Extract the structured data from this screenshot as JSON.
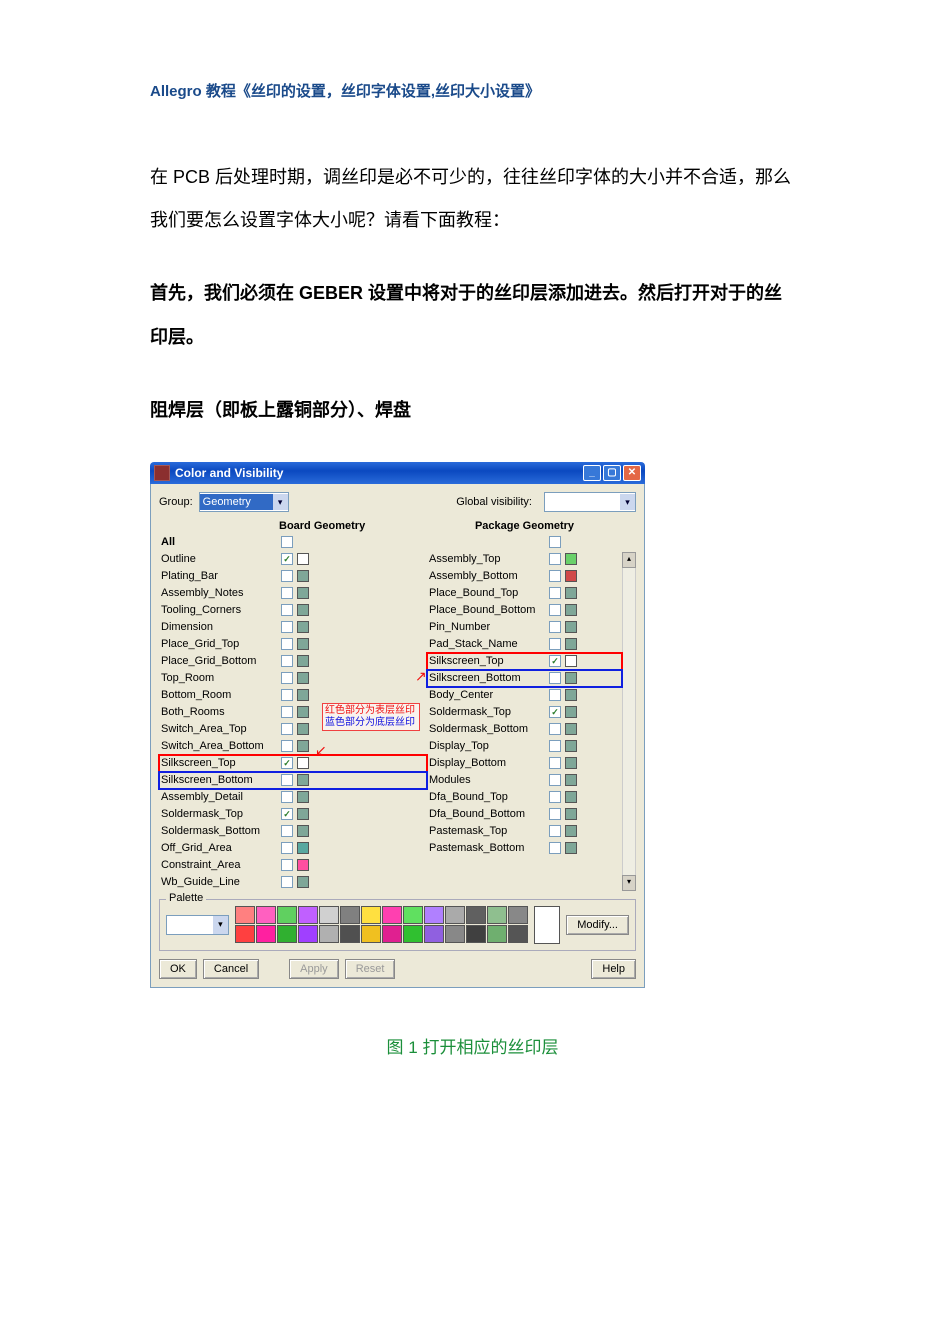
{
  "doc": {
    "title": "Allegro 教程《丝印的设置，丝印字体设置,丝印大小设置》",
    "p1": "在 PCB 后处理时期，调丝印是必不可少的，往往丝印字体的大小并不合适，那么我们要怎么设置字体大小呢？请看下面教程：",
    "p2": "首先，我们必须在 GEBER 设置中将对于的丝印层添加进去。然后打开对于的丝印层。",
    "p3": "阻焊层（即板上露铜部分）、焊盘",
    "caption": "图 1  打开相应的丝印层"
  },
  "dialog": {
    "title": "Color and Visibility",
    "group_label": "Group:",
    "group_value": "Geometry",
    "global_label": "Global visibility:",
    "hdr_left": "Board Geometry",
    "hdr_right": "Package Geometry",
    "all_label": "All",
    "left": [
      {
        "name": "Outline",
        "chk": true,
        "sw": "#ffffff"
      },
      {
        "name": "Plating_Bar",
        "chk": false,
        "sw": "#7fa798"
      },
      {
        "name": "Assembly_Notes",
        "chk": false,
        "sw": "#7fa798"
      },
      {
        "name": "Tooling_Corners",
        "chk": false,
        "sw": "#7fa798"
      },
      {
        "name": "Dimension",
        "chk": false,
        "sw": "#7fa798"
      },
      {
        "name": "Place_Grid_Top",
        "chk": false,
        "sw": "#7fa798"
      },
      {
        "name": "Place_Grid_Bottom",
        "chk": false,
        "sw": "#7fa798"
      },
      {
        "name": "Top_Room",
        "chk": false,
        "sw": "#7fa798"
      },
      {
        "name": "Bottom_Room",
        "chk": false,
        "sw": "#7fa798"
      },
      {
        "name": "Both_Rooms",
        "chk": false,
        "sw": "#7fa798"
      },
      {
        "name": "Switch_Area_Top",
        "chk": false,
        "sw": "#7fa798"
      },
      {
        "name": "Switch_Area_Bottom",
        "chk": false,
        "sw": "#7fa798"
      },
      {
        "name": "Silkscreen_Top",
        "chk": true,
        "sw": "#ffffff",
        "hl": "red"
      },
      {
        "name": "Silkscreen_Bottom",
        "chk": false,
        "sw": "#7fa798",
        "hl": "blue"
      },
      {
        "name": "Assembly_Detail",
        "chk": false,
        "sw": "#7fa798"
      },
      {
        "name": "Soldermask_Top",
        "chk": true,
        "sw": "#7fa798"
      },
      {
        "name": "Soldermask_Bottom",
        "chk": false,
        "sw": "#7fa798"
      },
      {
        "name": "Off_Grid_Area",
        "chk": false,
        "sw": "#58a8a0"
      },
      {
        "name": "Constraint_Area",
        "chk": false,
        "sw": "#ff4fa0"
      },
      {
        "name": "Wb_Guide_Line",
        "chk": false,
        "sw": "#7fa798"
      }
    ],
    "right": [
      {
        "name": "Assembly_Top",
        "chk": false,
        "sw": "#6ad06a"
      },
      {
        "name": "Assembly_Bottom",
        "chk": false,
        "sw": "#d04a4a"
      },
      {
        "name": "Place_Bound_Top",
        "chk": false,
        "sw": "#7fa798"
      },
      {
        "name": "Place_Bound_Bottom",
        "chk": false,
        "sw": "#7fa798"
      },
      {
        "name": "Pin_Number",
        "chk": false,
        "sw": "#7fa798"
      },
      {
        "name": "Pad_Stack_Name",
        "chk": false,
        "sw": "#7fa798"
      },
      {
        "name": "Silkscreen_Top",
        "chk": true,
        "sw": "#ffffff",
        "hl": "red"
      },
      {
        "name": "Silkscreen_Bottom",
        "chk": false,
        "sw": "#7fa798",
        "hl": "blue"
      },
      {
        "name": "Body_Center",
        "chk": false,
        "sw": "#7fa798"
      },
      {
        "name": "Soldermask_Top",
        "chk": true,
        "sw": "#7fa798"
      },
      {
        "name": "Soldermask_Bottom",
        "chk": false,
        "sw": "#7fa798"
      },
      {
        "name": "Display_Top",
        "chk": false,
        "sw": "#7fa798"
      },
      {
        "name": "Display_Bottom",
        "chk": false,
        "sw": "#7fa798"
      },
      {
        "name": "Modules",
        "chk": false,
        "sw": "#7fa798"
      },
      {
        "name": "Dfa_Bound_Top",
        "chk": false,
        "sw": "#7fa798"
      },
      {
        "name": "Dfa_Bound_Bottom",
        "chk": false,
        "sw": "#7fa798"
      },
      {
        "name": "Pastemask_Top",
        "chk": false,
        "sw": "#7fa798"
      },
      {
        "name": "Pastemask_Bottom",
        "chk": false,
        "sw": "#7fa798"
      }
    ],
    "annot_l1": "红色部分为表层丝印",
    "annot_l2": "蓝色部分为底层丝印",
    "palette_label": "Palette",
    "palette_colors": [
      "#ff8080",
      "#ff60c0",
      "#60d060",
      "#c060ff",
      "#d0d0d0",
      "#808080",
      "#ffe040",
      "#ff40b0",
      "#60e060",
      "#b080ff",
      "#aaaaaa",
      "#606060",
      "#8fbf8f",
      "#888888",
      "#ff4040",
      "#ff20a0",
      "#30b030",
      "#a040ff",
      "#b0b0b0",
      "#505050",
      "#f0c020",
      "#e02090",
      "#30c030",
      "#9060e0",
      "#888888",
      "#404040",
      "#6faf6f",
      "#555555"
    ],
    "modify": "Modify...",
    "ok": "OK",
    "cancel": "Cancel",
    "apply": "Apply",
    "reset": "Reset",
    "help": "Help"
  }
}
